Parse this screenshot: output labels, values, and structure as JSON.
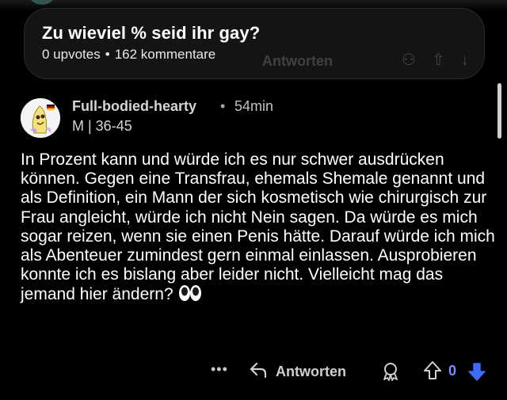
{
  "pinned_post": {
    "title": "Zu wieviel % seid ihr gay?",
    "upvotes": "0 upvotes",
    "separator": "•",
    "comments": "162 kommentare"
  },
  "comment": {
    "username": "Full-bodied-hearty",
    "separator": "•",
    "time_ago": "54min",
    "flair": "M | 36-45",
    "body": "In Prozent kann und würde ich es nur schwer ausdrücken können. Gegen eine Transfrau, ehemals Shemale genannt und als Definition, ein Mann der sich kosmetisch wie chirurgisch zur Frau angleicht, würde ich nicht Nein sagen. Da würde es mich sogar reizen, wenn sie einen Penis hätte. Darauf würde ich mich als Abenteuer zumindest gern einmal einlassen. Ausprobieren konnte ich es bislang aber leider nicht. Vielleicht mag das jemand hier ändern?",
    "emoji": "eyes-emoji"
  },
  "actions": {
    "more_label": "•••",
    "reply_label": "Antworten",
    "score": "0",
    "award_icon": "award-icon",
    "upvote_icon": "upvote-arrow-icon",
    "downvote_icon": "downvote-arrow-icon",
    "downvote_color": "#3e6bff",
    "score_color": "#7b8cff"
  },
  "background_ghost": {
    "reply_label": "Antworten"
  }
}
